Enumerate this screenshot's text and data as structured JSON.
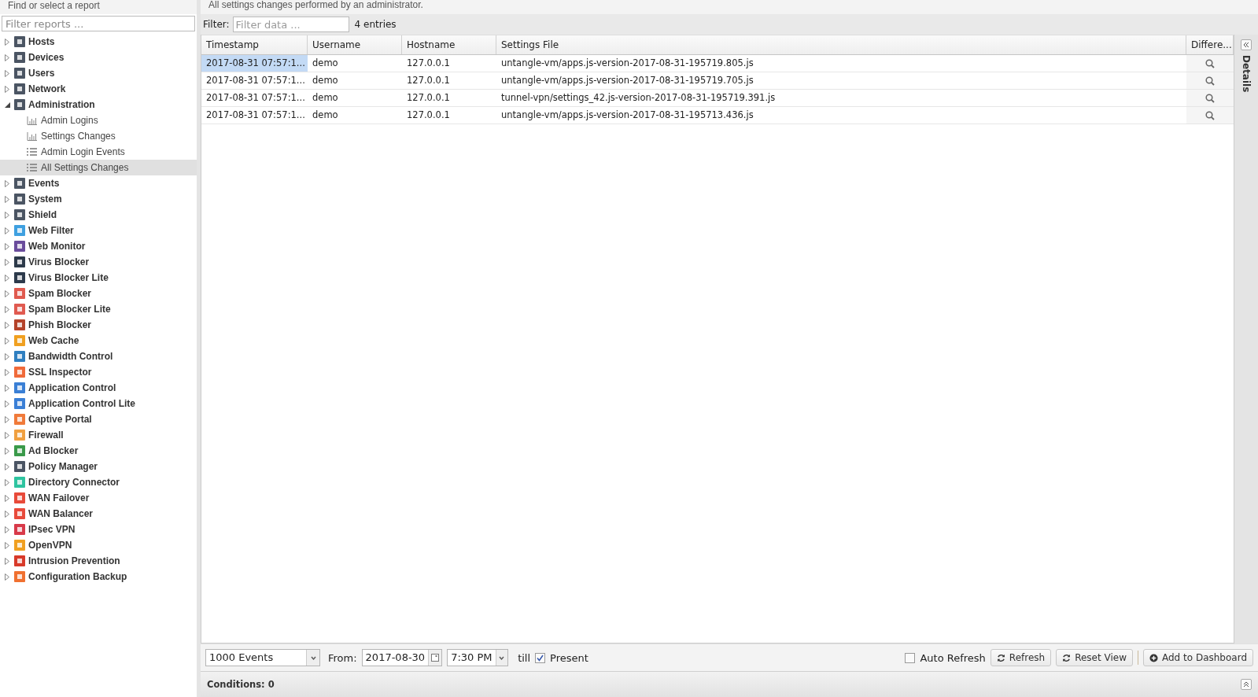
{
  "sidebar": {
    "title": "Find or select a report",
    "search": {
      "placeholder": "Filter reports ..."
    },
    "items": [
      {
        "label": "Hosts",
        "expanded": false,
        "selected": false,
        "color": "#4b5563"
      },
      {
        "label": "Devices",
        "expanded": false,
        "selected": false,
        "color": "#4b5563"
      },
      {
        "label": "Users",
        "expanded": false,
        "selected": false,
        "color": "#4b5563"
      },
      {
        "label": "Network",
        "expanded": false,
        "selected": false,
        "color": "#4b5563"
      },
      {
        "label": "Administration",
        "expanded": true,
        "selected": false,
        "color": "#4b5563",
        "children": [
          {
            "label": "Admin Logins",
            "kind": "chart",
            "selected": false
          },
          {
            "label": "Settings Changes",
            "kind": "chart",
            "selected": false
          },
          {
            "label": "Admin Login Events",
            "kind": "list",
            "selected": false
          },
          {
            "label": "All Settings Changes",
            "kind": "list",
            "selected": true
          }
        ]
      },
      {
        "label": "Events",
        "expanded": false,
        "selected": false,
        "color": "#4b5563"
      },
      {
        "label": "System",
        "expanded": false,
        "selected": false,
        "color": "#4b5563"
      },
      {
        "label": "Shield",
        "expanded": false,
        "selected": false,
        "color": "#4b5563"
      },
      {
        "label": "Web Filter",
        "expanded": false,
        "selected": false,
        "color": "#3fa0e0"
      },
      {
        "label": "Web Monitor",
        "expanded": false,
        "selected": false,
        "color": "#6a4c9c"
      },
      {
        "label": "Virus Blocker",
        "expanded": false,
        "selected": false,
        "color": "#2d3a4a"
      },
      {
        "label": "Virus Blocker Lite",
        "expanded": false,
        "selected": false,
        "color": "#2d3a4b"
      },
      {
        "label": "Spam Blocker",
        "expanded": false,
        "selected": false,
        "color": "#e05a4f"
      },
      {
        "label": "Spam Blocker Lite",
        "expanded": false,
        "selected": false,
        "color": "#e05a50"
      },
      {
        "label": "Phish Blocker",
        "expanded": false,
        "selected": false,
        "color": "#b5432a"
      },
      {
        "label": "Web Cache",
        "expanded": false,
        "selected": false,
        "color": "#f0a020"
      },
      {
        "label": "Bandwidth Control",
        "expanded": false,
        "selected": false,
        "color": "#2f7fc0"
      },
      {
        "label": "SSL Inspector",
        "expanded": false,
        "selected": false,
        "color": "#f06a3a"
      },
      {
        "label": "Application Control",
        "expanded": false,
        "selected": false,
        "color": "#3a7fd5"
      },
      {
        "label": "Application Control Lite",
        "expanded": false,
        "selected": false,
        "color": "#3a7fd6"
      },
      {
        "label": "Captive Portal",
        "expanded": false,
        "selected": false,
        "color": "#f07a3a"
      },
      {
        "label": "Firewall",
        "expanded": false,
        "selected": false,
        "color": "#f0a040"
      },
      {
        "label": "Ad Blocker",
        "expanded": false,
        "selected": false,
        "color": "#3a9a4a"
      },
      {
        "label": "Policy Manager",
        "expanded": false,
        "selected": false,
        "color": "#4b5564"
      },
      {
        "label": "Directory Connector",
        "expanded": false,
        "selected": false,
        "color": "#2ec4a0"
      },
      {
        "label": "WAN Failover",
        "expanded": false,
        "selected": false,
        "color": "#e84a3a"
      },
      {
        "label": "WAN Balancer",
        "expanded": false,
        "selected": false,
        "color": "#e84a3b"
      },
      {
        "label": "IPsec VPN",
        "expanded": false,
        "selected": false,
        "color": "#d83a4a"
      },
      {
        "label": "OpenVPN",
        "expanded": false,
        "selected": false,
        "color": "#f0a021"
      },
      {
        "label": "Intrusion Prevention",
        "expanded": false,
        "selected": false,
        "color": "#d83a2a"
      },
      {
        "label": "Configuration Backup",
        "expanded": false,
        "selected": false,
        "color": "#f07030"
      }
    ]
  },
  "report": {
    "description": "All settings changes performed by an administrator.",
    "filter": {
      "label": "Filter:",
      "placeholder": "Filter data ...",
      "count": "4 entries"
    },
    "table": {
      "columns": [
        "Timestamp",
        "Username",
        "Hostname",
        "Settings File",
        "Differe..."
      ],
      "rows": [
        {
          "selected": true,
          "cells": [
            "2017-08-31 07:57:1...",
            "demo",
            "127.0.0.1",
            "untangle-vm/apps.js-version-2017-08-31-195719.805.js"
          ]
        },
        {
          "selected": false,
          "cells": [
            "2017-08-31 07:57:1...",
            "demo",
            "127.0.0.1",
            "untangle-vm/apps.js-version-2017-08-31-195719.705.js"
          ]
        },
        {
          "selected": false,
          "cells": [
            "2017-08-31 07:57:1...",
            "demo",
            "127.0.0.1",
            "tunnel-vpn/settings_42.js-version-2017-08-31-195719.391.js"
          ]
        },
        {
          "selected": false,
          "cells": [
            "2017-08-31 07:57:1...",
            "demo",
            "127.0.0.1",
            "untangle-vm/apps.js-version-2017-08-31-195713.436.js"
          ]
        }
      ]
    },
    "details_tab": "Details",
    "toolbar": {
      "limit": "1000 Events",
      "from_label": "From:",
      "from_date": "2017-08-30",
      "from_time": "7:30 PM",
      "till_label": "till",
      "present": {
        "label": "Present",
        "checked": true
      },
      "auto_refresh": {
        "label": "Auto Refresh",
        "checked": false
      },
      "buttons": [
        {
          "kind": "refresh",
          "label": "Refresh"
        },
        {
          "kind": "reset",
          "label": "Reset View"
        },
        {
          "kind": "add",
          "label": "Add to Dashboard"
        }
      ]
    },
    "conditions": "Conditions: 0"
  }
}
